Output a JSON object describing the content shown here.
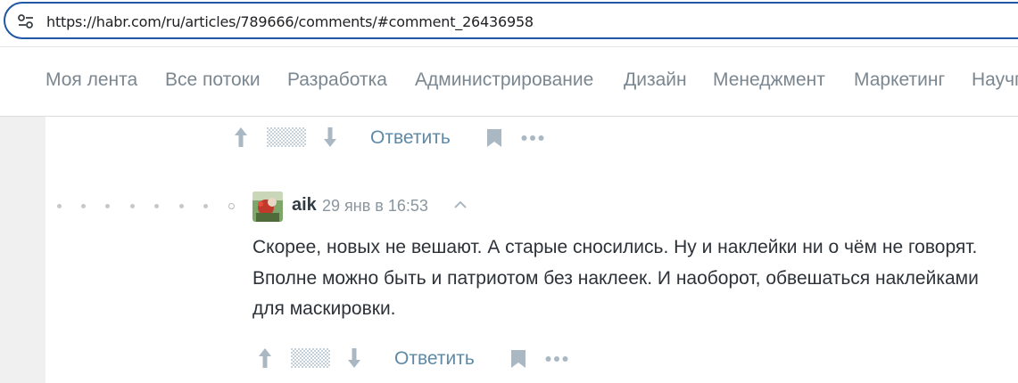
{
  "browser": {
    "url": "https://habr.com/ru/articles/789666/comments/#comment_26436958"
  },
  "nav": {
    "items": [
      "Моя лента",
      "Все потоки",
      "Разработка",
      "Администрирование",
      "Дизайн",
      "Менеджмент",
      "Маркетинг",
      "Научп"
    ]
  },
  "comment_actions_top": {
    "reply_label": "Ответить"
  },
  "comment": {
    "username": "aik",
    "timestamp": "29 янв в 16:53",
    "text": "Скорее, новых не вешают. А старые сносились. Ну и наклейки ни о чём не говорят. Вполне можно быть и патриотом без наклеек. И наоборот, обвешаться наклейками для маскировки.",
    "actions": {
      "reply_label": "Ответить"
    }
  },
  "colors": {
    "accent_link": "#5e8aa8",
    "nav_text": "#7b8790",
    "url_border": "#1f57a5"
  }
}
